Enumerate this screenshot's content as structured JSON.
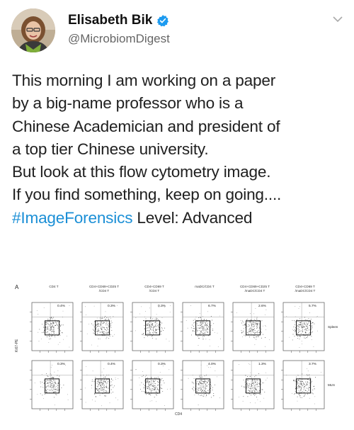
{
  "author": {
    "name": "Elisabeth Bik",
    "handle": "@MicrobiomDigest",
    "verified": true,
    "avatar_icon": "profile-photo",
    "menu_icon": "chevron-down-icon"
  },
  "tweet": {
    "lines": [
      "This morning I am working on a paper",
      "by a big-name professor who is a",
      "Chinese Academician and president of",
      "a top tier Chinese university.",
      "But look at this flow cytometry image.",
      "If you find something, keep on going....",
      "Level: Advanced"
    ],
    "hashtag": "#ImageForensics",
    "link_color": "#1b8fd6"
  },
  "figure": {
    "panel_letter": "A",
    "column_headers": [
      [
        "CD4 T",
        ""
      ],
      [
        "CD4+CD69+CD25 T",
        "/CD4 T"
      ],
      [
        "CD4+CD69 T",
        "/CD4 T"
      ],
      [
        "maDC/CD4 T",
        ""
      ],
      [
        "CD4+CD69+CD25 T",
        "/maDC/CD4 T"
      ],
      [
        "CD4+CD69 T",
        "/maDC/CD4 T"
      ]
    ],
    "rows": [
      {
        "label": "Spleen",
        "percents": [
          "0.4%",
          "0.3%",
          "0.3%",
          "6.7%",
          "2.6%",
          "5.7%"
        ]
      },
      {
        "label": "MLN",
        "percents": [
          "0.3%",
          "0.4%",
          "0.3%",
          "4.0%",
          "1.3%",
          "3.7%"
        ]
      }
    ],
    "y_axis_label": "Ki67-PE",
    "x_axis_label": "CD4"
  }
}
